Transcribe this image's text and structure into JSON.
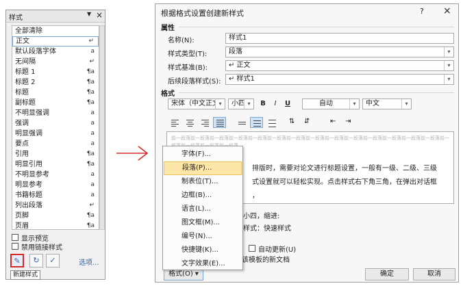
{
  "styles_pane": {
    "title": "样式",
    "close": "×",
    "items": [
      {
        "label": "全部清除",
        "mark": ""
      },
      {
        "label": "正文",
        "mark": "↵"
      },
      {
        "label": "默认段落字体",
        "mark": "a"
      },
      {
        "label": "无间隔",
        "mark": "↵"
      },
      {
        "label": "标题 1",
        "mark": "¶a"
      },
      {
        "label": "标题 2",
        "mark": "¶a"
      },
      {
        "label": "标题",
        "mark": "¶a"
      },
      {
        "label": "副标题",
        "mark": "¶a"
      },
      {
        "label": "不明显强调",
        "mark": "a"
      },
      {
        "label": "强调",
        "mark": "a"
      },
      {
        "label": "明显强调",
        "mark": "a"
      },
      {
        "label": "要点",
        "mark": "a"
      },
      {
        "label": "引用",
        "mark": "¶a"
      },
      {
        "label": "明显引用",
        "mark": "¶a"
      },
      {
        "label": "不明显参考",
        "mark": "a"
      },
      {
        "label": "明显参考",
        "mark": "a"
      },
      {
        "label": "书籍标题",
        "mark": "a"
      },
      {
        "label": "列出段落",
        "mark": "↵"
      },
      {
        "label": "页脚",
        "mark": "¶a"
      },
      {
        "label": "页眉",
        "mark": "¶a"
      }
    ],
    "show_preview": "显示预览",
    "disable_linked": "禁用链接样式",
    "options_link": "选项...",
    "tooltip": "新建样式"
  },
  "dialog": {
    "title": "根据格式设置创建新样式",
    "help": "?",
    "close": "×",
    "section_props": "属性",
    "name_label": "名称(N):",
    "name_value": "样式1",
    "type_label": "样式类型(T):",
    "type_value": "段落",
    "based_label": "样式基准(B):",
    "based_value": "↵ 正文",
    "next_label": "后续段落样式(S):",
    "next_value": "↵ 样式1",
    "section_format": "格式",
    "font_value": "宋体（中文正文",
    "size_value": "小四",
    "bold": "B",
    "italic": "I",
    "underline": "U",
    "color_value": "自动",
    "lang_value": "中文",
    "preview_prev": "前一段落前一段落前一段落前一段落前一段落前一段落前一段落前一段落前一段落前一段落前一段落前一段落前一段落前一段落前一段落前一段落前一段落前一段落",
    "preview_line1": "排版时，需要对论文进行标题设置，一般有一级、二级、三级",
    "preview_line2": "式设置就可以轻松实现。点击样式右下角三角，在弹出对话框",
    "preview_line3": "，",
    "desc_line1": "小四，缩进:",
    "desc_line2": "样式：快速样式",
    "auto_update": "自动更新(U)",
    "new_doc_text": "该模板的新文档",
    "format_button": "格式(O) ▾",
    "ok_button": "确定",
    "cancel_button": "取消"
  },
  "menu": {
    "items": [
      "字体(F)...",
      "段落(P)...",
      "制表位(T)...",
      "边框(B)...",
      "语言(L)...",
      "图文框(M)...",
      "编号(N)...",
      "快捷键(K)...",
      "文字效果(E)..."
    ]
  },
  "colors": {
    "arrow": "#d42a2a",
    "highlight": "#fde7a8",
    "selection_border": "#7aa7d8"
  }
}
